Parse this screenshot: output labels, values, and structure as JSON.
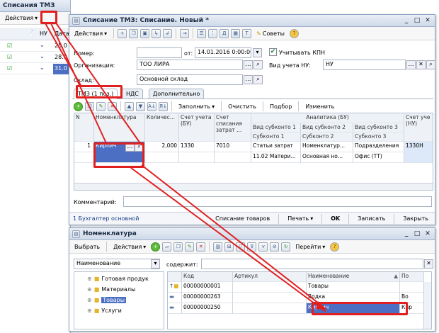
{
  "back_window": {
    "title": "Списания ТМЗ",
    "actions_label": "Действия",
    "columns": [
      "НУ",
      "Дата"
    ],
    "rows": [
      {
        "date": "25.0"
      },
      {
        "date": "28.0"
      },
      {
        "date": "31.0"
      }
    ]
  },
  "doc": {
    "title": "Списание ТМЗ: Списание. Новый *",
    "actions_label": "Действия",
    "advice_label": "Советы",
    "number_label": "Номер:",
    "number_value": "",
    "from_label": "от:",
    "date_value": "14.01.2016 0:00:00",
    "kpn_label": "Учитывать КПН",
    "org_label": "Организация:",
    "org_value": "ТОО ЛИРА",
    "nu_label": "Вид учета НУ:",
    "nu_value": "НУ",
    "warehouse_label": "Склад:",
    "warehouse_value": "Основной склад",
    "tabs": [
      "ТМЗ (1 поз.)",
      "НДС",
      "Дополнительно"
    ],
    "table_toolbar": {
      "fill": "Заполнить",
      "clear": "Очистить",
      "pick": "Подбор",
      "change": "Изменить"
    },
    "headers": {
      "num": "N",
      "item": "Номенклатура",
      "qty": "Количес...",
      "account": "Счет учета (БУ)",
      "writeoff": "Счет списания затрат ...",
      "analytics": "Аналитика (БУ)",
      "sub1": "Вид субконто 1",
      "sub2": "Вид субконто 2",
      "sub3": "Вид субконто 3",
      "s1": "Субконто 1",
      "s2": "Субконто 2",
      "s3": "Субконто 3",
      "nu_account": "Счет уче (НУ)"
    },
    "row": {
      "num": "1",
      "item": "Кирпич",
      "qty": "2,000",
      "account": "1330",
      "writeoff": "7010",
      "sub1": "Статьи затрат",
      "sub2": "Номенклатур...",
      "sub3": "Подразделения",
      "s1": "11.02 Матери...",
      "s2": "Основная но...",
      "s3": "Офис (ТТ)",
      "nu_account": "1330Н"
    },
    "comment_label": "Комментарий:",
    "comment_value": "",
    "footer": {
      "user": "1 Бухгалтер основной",
      "print_form": "Списание товаров",
      "print": "Печать",
      "ok": "OK",
      "save": "Записать",
      "close": "Закрыть"
    }
  },
  "nom": {
    "title": "Номенклатура",
    "select_label": "Выбрать",
    "actions_label": "Действия",
    "goto_label": "Перейти",
    "sort_value": "Наименование",
    "contains_label": "содержит:",
    "contains_value": "",
    "tree": [
      "Готовая продук",
      "Материалы",
      "Товары",
      "Услуги"
    ],
    "headers": {
      "code": "Код",
      "article": "Артикул",
      "name": "Наименование",
      "extra": "По"
    },
    "rows": [
      {
        "code": "00000000001",
        "article": "",
        "name": "Товары",
        "extra": ""
      },
      {
        "code": "00000000263",
        "article": "",
        "name": "Водка",
        "extra": "Во"
      },
      {
        "code": "00000000250",
        "article": "",
        "name": "Кирпич",
        "extra": "Кир"
      }
    ]
  },
  "colors": {
    "accent_red": "#e02020",
    "selection": "#4c6fc4",
    "title_bar": "#cfd9e8"
  }
}
